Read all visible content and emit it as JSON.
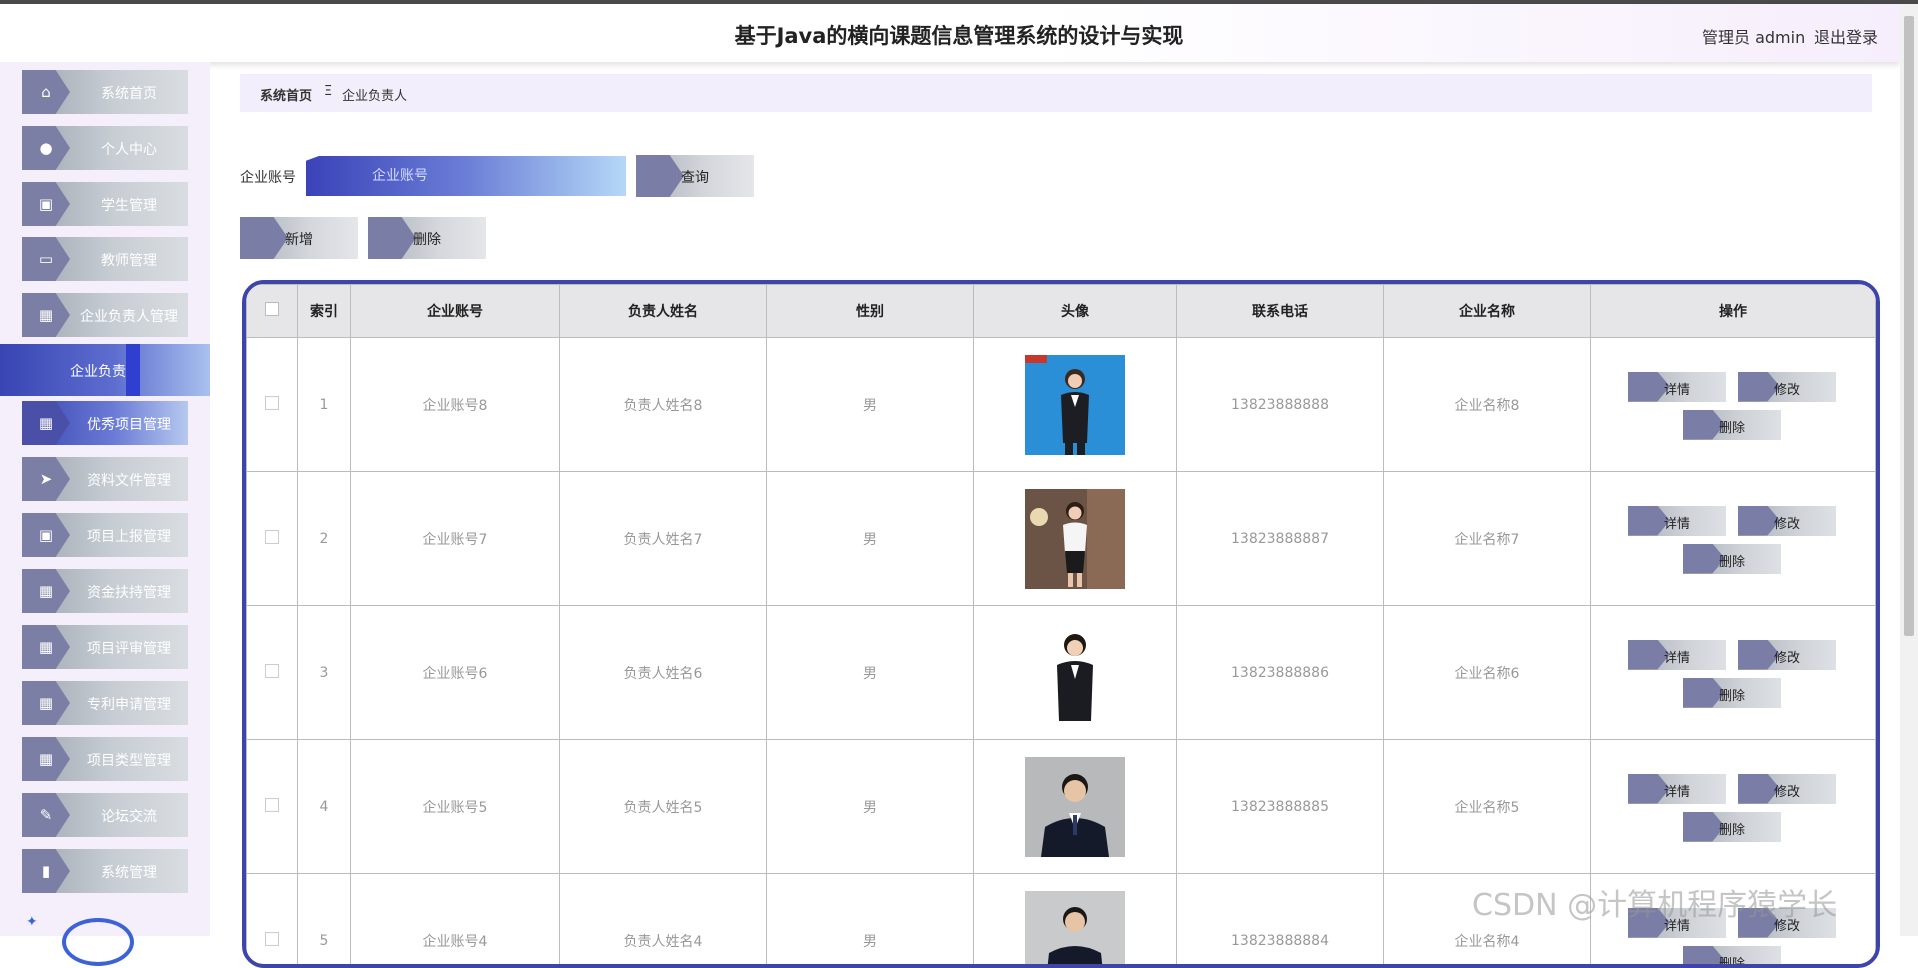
{
  "header": {
    "title": "基于Java的横向课题信息管理系统的设计与实现",
    "user_label": "管理员 admin",
    "logout_label": "退出登录"
  },
  "sidebar": {
    "items": [
      {
        "label": "系统首页",
        "icon": "home-icon"
      },
      {
        "label": "个人中心",
        "icon": "user-icon"
      },
      {
        "label": "学生管理",
        "icon": "clipboard-icon"
      },
      {
        "label": "教师管理",
        "icon": "monitor-icon"
      },
      {
        "label": "企业负责人管理",
        "icon": "grid-icon"
      },
      {
        "label": "优秀项目管理",
        "icon": "grid-icon"
      },
      {
        "label": "资料文件管理",
        "icon": "send-icon"
      },
      {
        "label": "项目上报管理",
        "icon": "clipboard-icon"
      },
      {
        "label": "资金扶持管理",
        "icon": "grid-icon"
      },
      {
        "label": "项目评审管理",
        "icon": "grid-icon"
      },
      {
        "label": "专利申请管理",
        "icon": "grid-icon"
      },
      {
        "label": "项目类型管理",
        "icon": "grid-icon"
      },
      {
        "label": "论坛交流",
        "icon": "comment-icon"
      },
      {
        "label": "系统管理",
        "icon": "chart-icon"
      }
    ],
    "sub_item": "企业负责人"
  },
  "breadcrumb": {
    "home": "系统首页",
    "separator": "Ξ",
    "current": "企业负责人"
  },
  "search": {
    "label": "企业账号",
    "placeholder": "企业账号",
    "value": "",
    "button": "查询"
  },
  "actions": {
    "add": "新增",
    "delete": "删除"
  },
  "table": {
    "headers": [
      "索引",
      "企业账号",
      "负责人姓名",
      "性别",
      "头像",
      "联系电话",
      "企业名称",
      "操作"
    ],
    "rows": [
      {
        "index": "1",
        "account": "企业账号8",
        "name": "负责人姓名8",
        "gender": "男",
        "phone": "13823888888",
        "company": "企业名称8"
      },
      {
        "index": "2",
        "account": "企业账号7",
        "name": "负责人姓名7",
        "gender": "男",
        "phone": "13823888887",
        "company": "企业名称7"
      },
      {
        "index": "3",
        "account": "企业账号6",
        "name": "负责人姓名6",
        "gender": "男",
        "phone": "13823888886",
        "company": "企业名称6"
      },
      {
        "index": "4",
        "account": "企业账号5",
        "name": "负责人姓名5",
        "gender": "男",
        "phone": "13823888885",
        "company": "企业名称5"
      },
      {
        "index": "5",
        "account": "企业账号4",
        "name": "负责人姓名4",
        "gender": "男",
        "phone": "13823888884",
        "company": "企业名称4"
      }
    ],
    "row_actions": {
      "detail": "详情",
      "edit": "修改",
      "delete": "删除"
    }
  },
  "watermark": "CSDN @计算机程序猿学长",
  "colors": {
    "accent": "#3e45a8",
    "menu_tab": "#7b7fa6",
    "active_gradient_start": "#3845b3"
  }
}
